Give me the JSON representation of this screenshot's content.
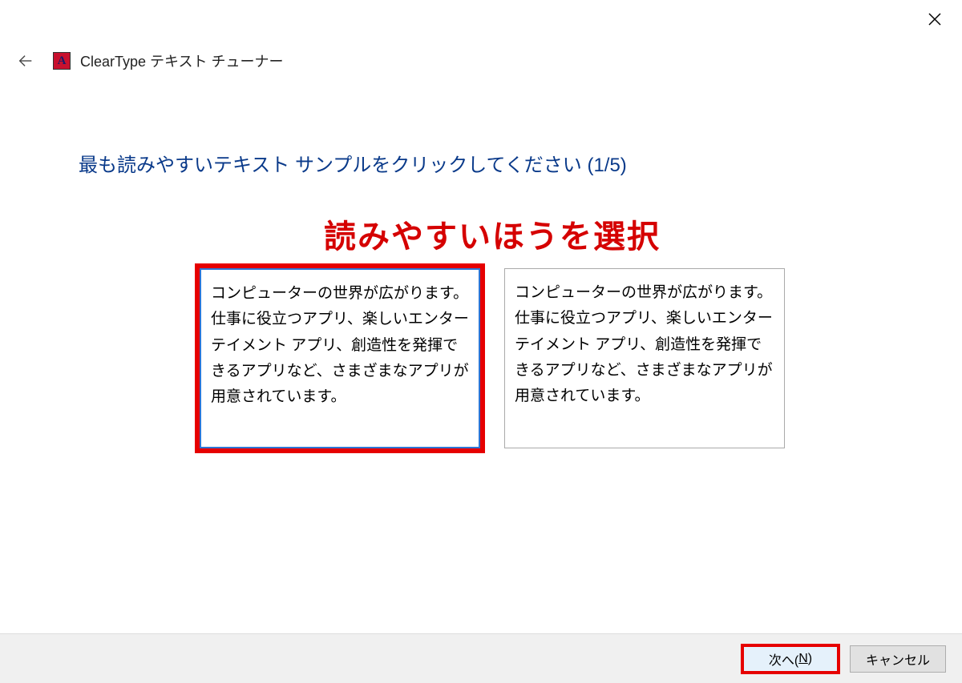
{
  "header": {
    "title": "ClearType テキスト チューナー",
    "icon_letter": "A"
  },
  "instruction": "最も読みやすいテキスト サンプルをクリックしてください (1/5)",
  "annotation": "読みやすいほうを選択",
  "samples": {
    "left": "コンピューターの世界が広がります。仕事に役立つアプリ、楽しいエンターテイメント アプリ、創造性を発揮できるアプリなど、さまざまなアプリが用意されています。",
    "right": "コンピューターの世界が広がります。仕事に役立つアプリ、楽しいエンターテイメント アプリ、創造性を発揮できるアプリなど、さまざまなアプリが用意されています。"
  },
  "footer": {
    "next_prefix": "次へ(",
    "next_key": "N",
    "next_suffix": ")",
    "cancel": "キャンセル"
  }
}
